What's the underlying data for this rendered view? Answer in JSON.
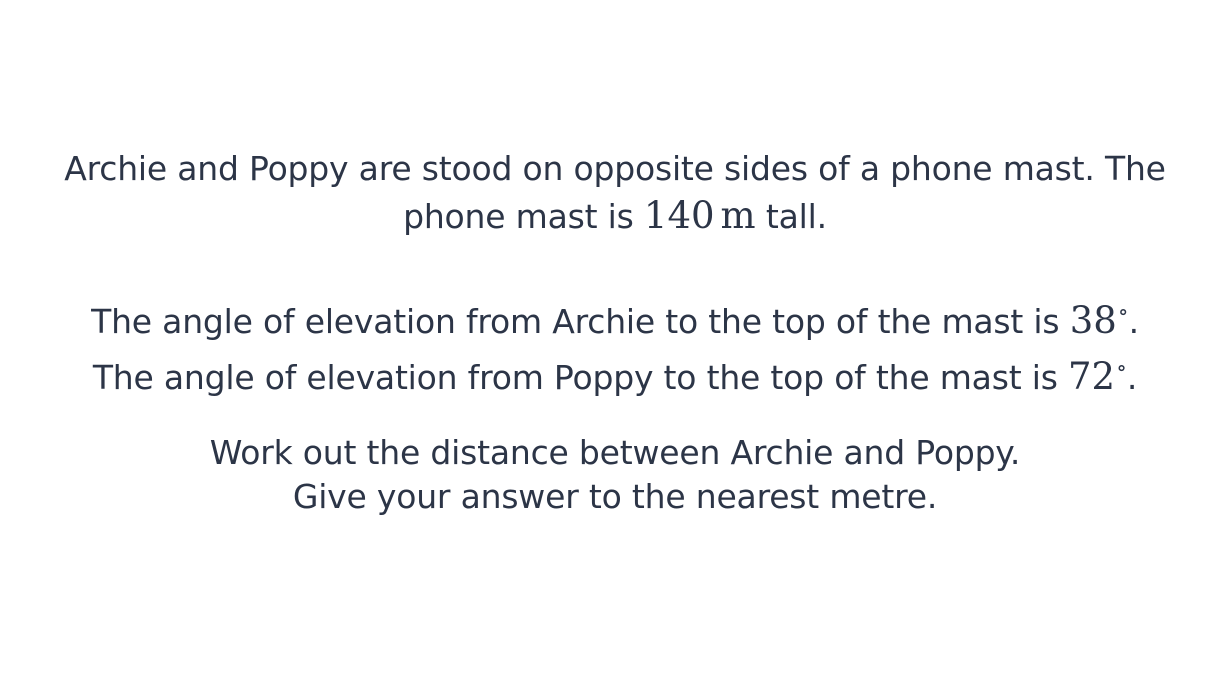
{
  "question": {
    "paragraph1": {
      "line1": "Archie and Poppy are stood on opposite sides of a phone mast. The",
      "line2_before": "phone mast is ",
      "height_value": "140",
      "height_unit": "m",
      "line2_after": " tall."
    },
    "paragraph2": {
      "line1_before": "The angle of elevation from Archie to the top of the mast is ",
      "archie_angle": "38",
      "line2_before": "The angle of elevation from Poppy to the top of the mast is ",
      "poppy_angle": "72",
      "degree_symbol": "∘",
      "period": "."
    },
    "paragraph3": {
      "line1": "Work out the distance between Archie and Poppy.",
      "line2": "Give your answer to the nearest metre."
    }
  },
  "colors": {
    "text": "#2c3547",
    "background": "#ffffff"
  }
}
